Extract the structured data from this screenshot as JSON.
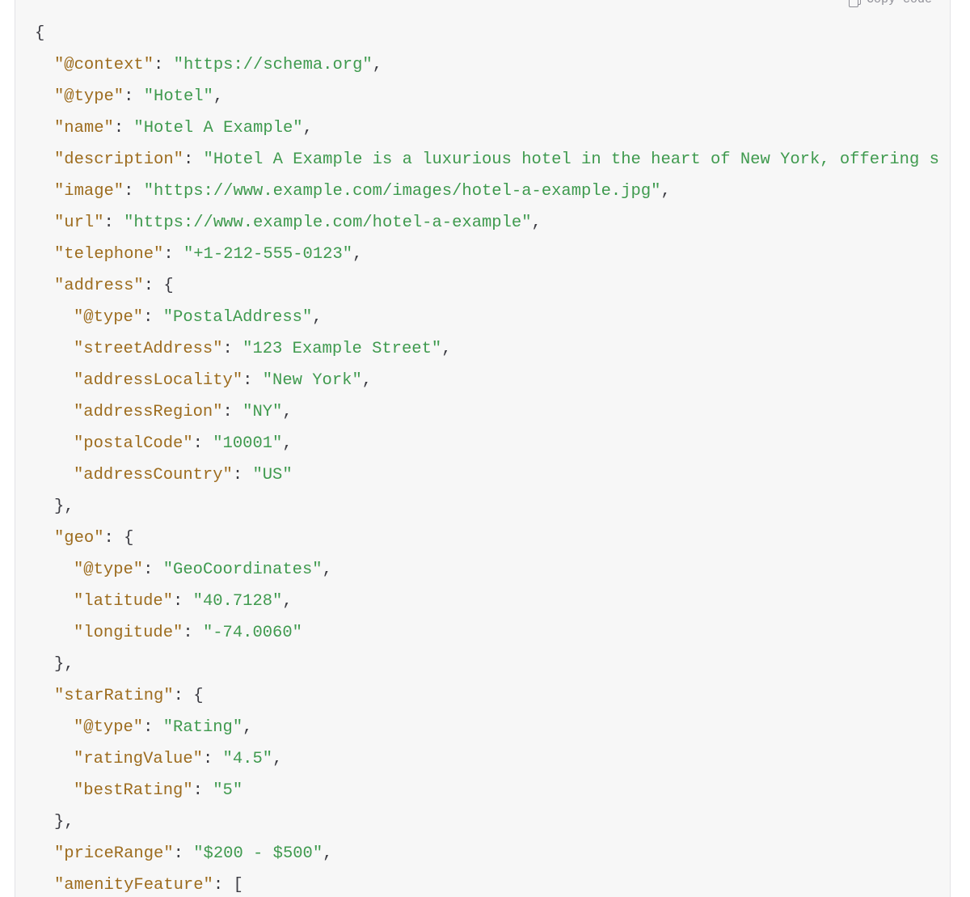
{
  "toolbar": {
    "copy_label": "Copy code",
    "copy_icon": "clipboard-icon"
  },
  "colors": {
    "panel_background": "#f7f7f7",
    "page_background": "#ffffff",
    "border": "#e3e3e6",
    "key": "#9d6c1e",
    "string": "#3f9a4e",
    "punctuation": "#3c3c43",
    "toolbar_text": "#8e8e96"
  },
  "code": {
    "language": "json",
    "lines": [
      {
        "indent": 0,
        "tokens": [
          {
            "t": "punct",
            "v": "{"
          }
        ]
      },
      {
        "indent": 1,
        "tokens": [
          {
            "t": "key",
            "v": "\"@context\""
          },
          {
            "t": "punct",
            "v": ": "
          },
          {
            "t": "str",
            "v": "\"https://schema.org\""
          },
          {
            "t": "punct",
            "v": ","
          }
        ]
      },
      {
        "indent": 1,
        "tokens": [
          {
            "t": "key",
            "v": "\"@type\""
          },
          {
            "t": "punct",
            "v": ": "
          },
          {
            "t": "str",
            "v": "\"Hotel\""
          },
          {
            "t": "punct",
            "v": ","
          }
        ]
      },
      {
        "indent": 1,
        "tokens": [
          {
            "t": "key",
            "v": "\"name\""
          },
          {
            "t": "punct",
            "v": ": "
          },
          {
            "t": "str",
            "v": "\"Hotel A Example\""
          },
          {
            "t": "punct",
            "v": ","
          }
        ]
      },
      {
        "indent": 1,
        "tokens": [
          {
            "t": "key",
            "v": "\"description\""
          },
          {
            "t": "punct",
            "v": ": "
          },
          {
            "t": "str",
            "v": "\"Hotel A Example is a luxurious hotel in the heart of New York, offering s"
          }
        ]
      },
      {
        "indent": 1,
        "tokens": [
          {
            "t": "key",
            "v": "\"image\""
          },
          {
            "t": "punct",
            "v": ": "
          },
          {
            "t": "str",
            "v": "\"https://www.example.com/images/hotel-a-example.jpg\""
          },
          {
            "t": "punct",
            "v": ","
          }
        ]
      },
      {
        "indent": 1,
        "tokens": [
          {
            "t": "key",
            "v": "\"url\""
          },
          {
            "t": "punct",
            "v": ": "
          },
          {
            "t": "str",
            "v": "\"https://www.example.com/hotel-a-example\""
          },
          {
            "t": "punct",
            "v": ","
          }
        ]
      },
      {
        "indent": 1,
        "tokens": [
          {
            "t": "key",
            "v": "\"telephone\""
          },
          {
            "t": "punct",
            "v": ": "
          },
          {
            "t": "str",
            "v": "\"+1-212-555-0123\""
          },
          {
            "t": "punct",
            "v": ","
          }
        ]
      },
      {
        "indent": 1,
        "tokens": [
          {
            "t": "key",
            "v": "\"address\""
          },
          {
            "t": "punct",
            "v": ": {"
          }
        ]
      },
      {
        "indent": 2,
        "tokens": [
          {
            "t": "key",
            "v": "\"@type\""
          },
          {
            "t": "punct",
            "v": ": "
          },
          {
            "t": "str",
            "v": "\"PostalAddress\""
          },
          {
            "t": "punct",
            "v": ","
          }
        ]
      },
      {
        "indent": 2,
        "tokens": [
          {
            "t": "key",
            "v": "\"streetAddress\""
          },
          {
            "t": "punct",
            "v": ": "
          },
          {
            "t": "str",
            "v": "\"123 Example Street\""
          },
          {
            "t": "punct",
            "v": ","
          }
        ]
      },
      {
        "indent": 2,
        "tokens": [
          {
            "t": "key",
            "v": "\"addressLocality\""
          },
          {
            "t": "punct",
            "v": ": "
          },
          {
            "t": "str",
            "v": "\"New York\""
          },
          {
            "t": "punct",
            "v": ","
          }
        ]
      },
      {
        "indent": 2,
        "tokens": [
          {
            "t": "key",
            "v": "\"addressRegion\""
          },
          {
            "t": "punct",
            "v": ": "
          },
          {
            "t": "str",
            "v": "\"NY\""
          },
          {
            "t": "punct",
            "v": ","
          }
        ]
      },
      {
        "indent": 2,
        "tokens": [
          {
            "t": "key",
            "v": "\"postalCode\""
          },
          {
            "t": "punct",
            "v": ": "
          },
          {
            "t": "str",
            "v": "\"10001\""
          },
          {
            "t": "punct",
            "v": ","
          }
        ]
      },
      {
        "indent": 2,
        "tokens": [
          {
            "t": "key",
            "v": "\"addressCountry\""
          },
          {
            "t": "punct",
            "v": ": "
          },
          {
            "t": "str",
            "v": "\"US\""
          }
        ]
      },
      {
        "indent": 1,
        "tokens": [
          {
            "t": "punct",
            "v": "},"
          }
        ]
      },
      {
        "indent": 1,
        "tokens": [
          {
            "t": "key",
            "v": "\"geo\""
          },
          {
            "t": "punct",
            "v": ": {"
          }
        ]
      },
      {
        "indent": 2,
        "tokens": [
          {
            "t": "key",
            "v": "\"@type\""
          },
          {
            "t": "punct",
            "v": ": "
          },
          {
            "t": "str",
            "v": "\"GeoCoordinates\""
          },
          {
            "t": "punct",
            "v": ","
          }
        ]
      },
      {
        "indent": 2,
        "tokens": [
          {
            "t": "key",
            "v": "\"latitude\""
          },
          {
            "t": "punct",
            "v": ": "
          },
          {
            "t": "str",
            "v": "\"40.7128\""
          },
          {
            "t": "punct",
            "v": ","
          }
        ]
      },
      {
        "indent": 2,
        "tokens": [
          {
            "t": "key",
            "v": "\"longitude\""
          },
          {
            "t": "punct",
            "v": ": "
          },
          {
            "t": "str",
            "v": "\"-74.0060\""
          }
        ]
      },
      {
        "indent": 1,
        "tokens": [
          {
            "t": "punct",
            "v": "},"
          }
        ]
      },
      {
        "indent": 1,
        "tokens": [
          {
            "t": "key",
            "v": "\"starRating\""
          },
          {
            "t": "punct",
            "v": ": {"
          }
        ]
      },
      {
        "indent": 2,
        "tokens": [
          {
            "t": "key",
            "v": "\"@type\""
          },
          {
            "t": "punct",
            "v": ": "
          },
          {
            "t": "str",
            "v": "\"Rating\""
          },
          {
            "t": "punct",
            "v": ","
          }
        ]
      },
      {
        "indent": 2,
        "tokens": [
          {
            "t": "key",
            "v": "\"ratingValue\""
          },
          {
            "t": "punct",
            "v": ": "
          },
          {
            "t": "str",
            "v": "\"4.5\""
          },
          {
            "t": "punct",
            "v": ","
          }
        ]
      },
      {
        "indent": 2,
        "tokens": [
          {
            "t": "key",
            "v": "\"bestRating\""
          },
          {
            "t": "punct",
            "v": ": "
          },
          {
            "t": "str",
            "v": "\"5\""
          }
        ]
      },
      {
        "indent": 1,
        "tokens": [
          {
            "t": "punct",
            "v": "},"
          }
        ]
      },
      {
        "indent": 1,
        "tokens": [
          {
            "t": "key",
            "v": "\"priceRange\""
          },
          {
            "t": "punct",
            "v": ": "
          },
          {
            "t": "str",
            "v": "\"$200 - $500\""
          },
          {
            "t": "punct",
            "v": ","
          }
        ]
      },
      {
        "indent": 1,
        "tokens": [
          {
            "t": "key",
            "v": "\"amenityFeature\""
          },
          {
            "t": "punct",
            "v": ": ["
          }
        ]
      }
    ]
  }
}
